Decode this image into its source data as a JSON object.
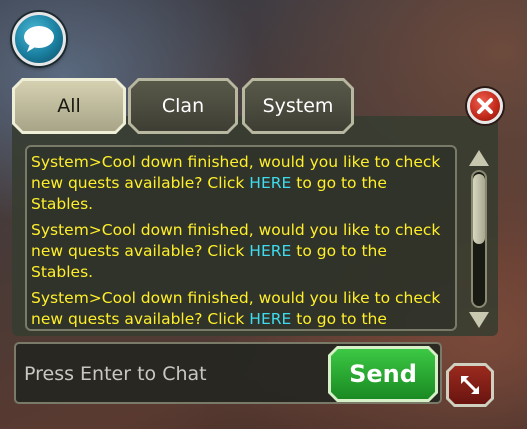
{
  "tabs": [
    {
      "label": "All",
      "active": true
    },
    {
      "label": "Clan",
      "active": false
    },
    {
      "label": "System",
      "active": false
    }
  ],
  "messages": [
    {
      "before": "System>Cool down finished, would you like to check new quests available? Click ",
      "link": "HERE",
      "after": " to go to the Stables."
    },
    {
      "before": "System>Cool down finished, would you like to check new quests available? Click ",
      "link": "HERE",
      "after": " to go to the Stables."
    },
    {
      "before": "System>Cool down finished, would you like to check new quests available? Click ",
      "link": "HERE",
      "after": " to go to the Stables."
    }
  ],
  "input": {
    "placeholder": "Press Enter to Chat",
    "value": ""
  },
  "send_label": "Send",
  "scroll_position": 0.0,
  "icons": {
    "chat_toggle": "speech-bubble-icon",
    "close": "close-x-icon",
    "resize": "resize-arrows-icon",
    "scroll_up": "arrow-up-icon",
    "scroll_down": "arrow-down-icon"
  },
  "colors": {
    "message_text": "#ffef2a",
    "link_text": "#3fdcf0",
    "send_button": "#2aa832",
    "close_button": "#c02818"
  }
}
